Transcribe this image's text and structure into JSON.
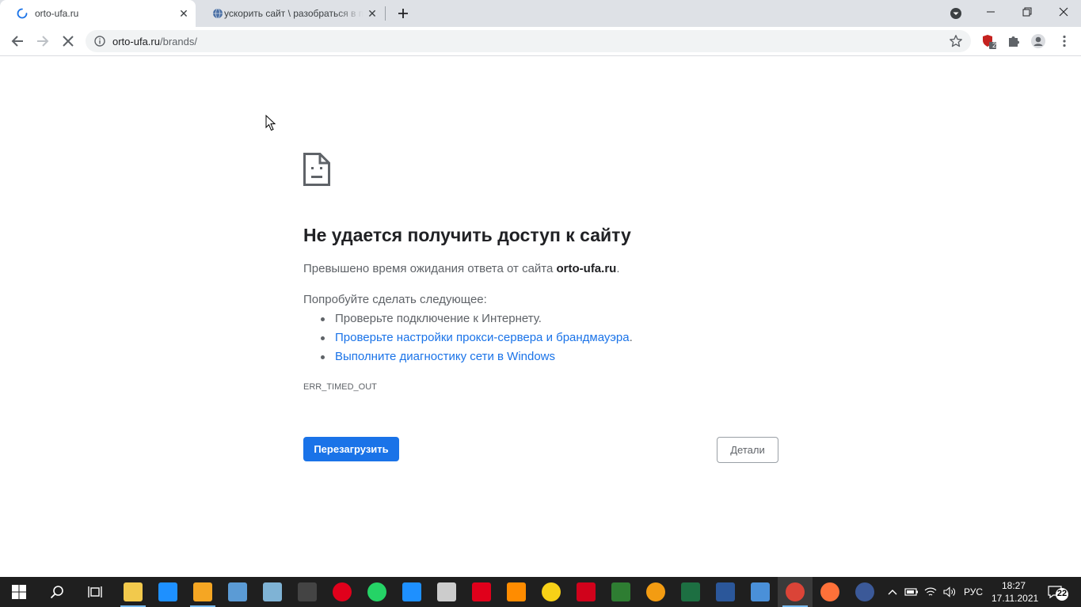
{
  "tabs": [
    {
      "title": "orto-ufa.ru",
      "active": true,
      "icon": "loading-spinner-icon"
    },
    {
      "title": "ускорить сайт \\ разобраться в п",
      "active": false,
      "icon": "globe-icon"
    }
  ],
  "address_bar": {
    "host": "orto-ufa.ru",
    "path": "/brands/"
  },
  "error_page": {
    "title": "Не удается получить доступ к сайту",
    "message_prefix": "Превышено время ожидания ответа от сайта ",
    "message_host": "orto-ufa.ru",
    "message_suffix": ".",
    "try_heading": "Попробуйте сделать следующее:",
    "suggestions": [
      {
        "text": "Проверьте подключение к Интернету.",
        "link": false
      },
      {
        "text": "Проверьте настройки прокси-сервера и брандмауэра",
        "link": true,
        "suffix": "."
      },
      {
        "text": "Выполните диагностику сети в Windows",
        "link": true,
        "suffix": ""
      }
    ],
    "error_code": "ERR_TIMED_OUT",
    "reload_label": "Перезагрузить",
    "details_label": "Детали"
  },
  "extensions": {
    "badge_count": "2"
  },
  "taskbar": {
    "apps": [
      {
        "name": "file-explorer",
        "color": "#f2c94c"
      },
      {
        "name": "internet-explorer",
        "color": "#1e90ff"
      },
      {
        "name": "photo-editor",
        "color": "#f5a623"
      },
      {
        "name": "control-panel",
        "color": "#5b9bd5"
      },
      {
        "name": "notes",
        "color": "#7fb3d5"
      },
      {
        "name": "calculator",
        "color": "#444444"
      },
      {
        "name": "opera",
        "color": "#e0001b"
      },
      {
        "name": "whatsapp",
        "color": "#25d366"
      },
      {
        "name": "snipping-tool",
        "color": "#1e90ff"
      },
      {
        "name": "app-figure",
        "color": "#cccccc"
      },
      {
        "name": "acrobat",
        "color": "#e0001b"
      },
      {
        "name": "paint",
        "color": "#ff8c00"
      },
      {
        "name": "1c",
        "color": "#f7d117"
      },
      {
        "name": "filezilla",
        "color": "#d0021b"
      },
      {
        "name": "image-app",
        "color": "#2e7d32"
      },
      {
        "name": "camera-app",
        "color": "#f39c12"
      },
      {
        "name": "excel",
        "color": "#1d6f42"
      },
      {
        "name": "word",
        "color": "#2b579a"
      },
      {
        "name": "remote-desktop",
        "color": "#4a90d9"
      },
      {
        "name": "chrome",
        "color": "#db4437"
      },
      {
        "name": "firefox",
        "color": "#ff7139"
      },
      {
        "name": "vpn",
        "color": "#3b5998"
      }
    ],
    "language": "РУС",
    "time": "18:27",
    "date": "17.11.2021",
    "notifications": "22"
  }
}
